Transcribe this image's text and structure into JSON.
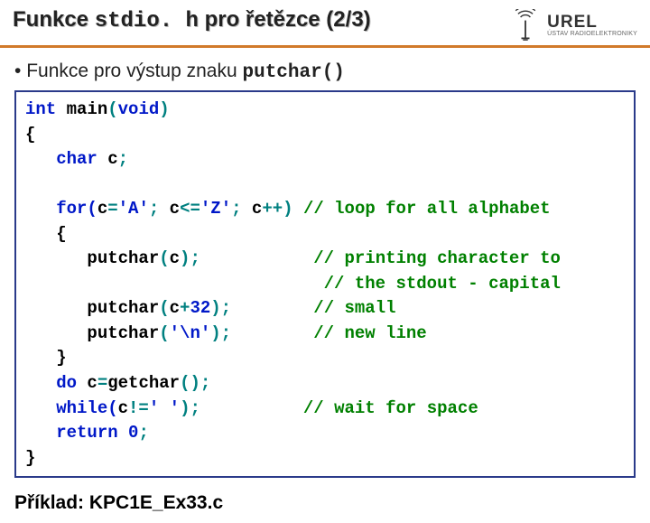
{
  "header": {
    "title_prefix": "Funkce ",
    "title_mono": "stdio. h",
    "title_suffix": " pro řetězce (2/3)",
    "logo_main": "UREL",
    "logo_sub": "ÚSTAV RADIOELEKTRONIKY"
  },
  "bullet": {
    "dot": "•  ",
    "text": "Funkce pro výstup znaku ",
    "mono": "putchar()"
  },
  "code": {
    "l1a": "int",
    "l1b": " main",
    "l1c": "(",
    "l1d": "void",
    "l1e": ")",
    "l2": "{",
    "l3a": "   char",
    "l3b": " c",
    "l3c": ";",
    "blank1": "",
    "l4a": "   for(",
    "l4b": "c",
    "l4c": "=",
    "l4d": "'A'",
    "l4e": "; ",
    "l4f": "c",
    "l4g": "<=",
    "l4h": "'Z'",
    "l4i": "; ",
    "l4j": "c",
    "l4k": "++) ",
    "l4l": "// loop for all alphabet",
    "l5": "   {",
    "l6a": "      putchar",
    "l6b": "(",
    "l6c": "c",
    "l6d": ");           ",
    "l6e": "// printing character to",
    "l7a": "                             ",
    "l7b": "// the stdout - capital",
    "l8a": "      putchar",
    "l8b": "(",
    "l8c": "c",
    "l8d": "+",
    "l8e": "32",
    "l8f": ");        ",
    "l8g": "// small",
    "l9a": "      putchar",
    "l9b": "(",
    "l9c": "'\\n'",
    "l9d": ");        ",
    "l9e": "// new line",
    "l10": "   }",
    "l11a": "   do ",
    "l11b": "c",
    "l11c": "=",
    "l11d": "getchar",
    "l11e": "();",
    "l12a": "   while(",
    "l12b": "c",
    "l12c": "!=",
    "l12d": "' '",
    "l12e": ");          ",
    "l12f": "// wait for space",
    "l13a": "   return",
    "l13b": " 0",
    "l13c": ";",
    "l14": "}"
  },
  "example": {
    "text": "Příklad: KPC1E_Ex33.c"
  }
}
